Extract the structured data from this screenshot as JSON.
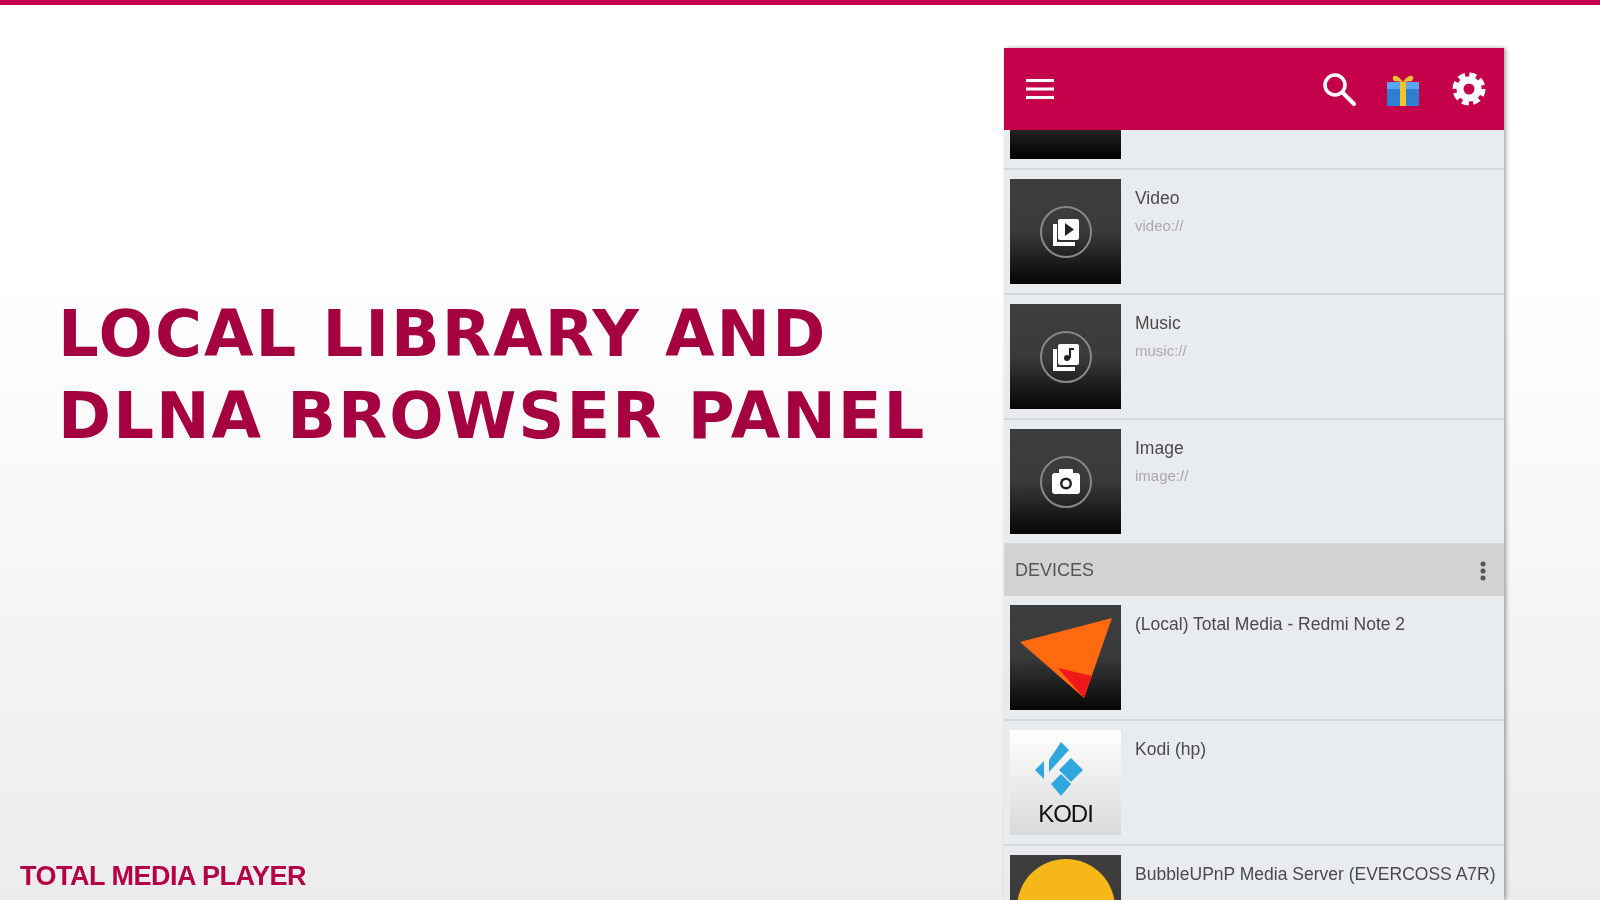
{
  "slide": {
    "title_lines": [
      "LOCAL LIBRARY AND",
      "DLNA BROWSER PANEL"
    ],
    "footer": "TOTAL MEDIA PLAYER"
  },
  "library": [
    {
      "kind": "cut"
    },
    {
      "kind": "video",
      "title": "Video",
      "path": "video://"
    },
    {
      "kind": "music",
      "title": "Music",
      "path": "music://"
    },
    {
      "kind": "image",
      "title": "Image",
      "path": "image://"
    }
  ],
  "devices_section": {
    "title": "DEVICES"
  },
  "devices": [
    {
      "kind": "local",
      "name": "(Local) Total Media - Redmi Note 2"
    },
    {
      "kind": "kodi",
      "name": "Kodi (hp)",
      "logo_text": "KODI"
    },
    {
      "kind": "bubble",
      "name": "BubbleUPnP Media Server (EVERCOSS A7R)"
    }
  ]
}
